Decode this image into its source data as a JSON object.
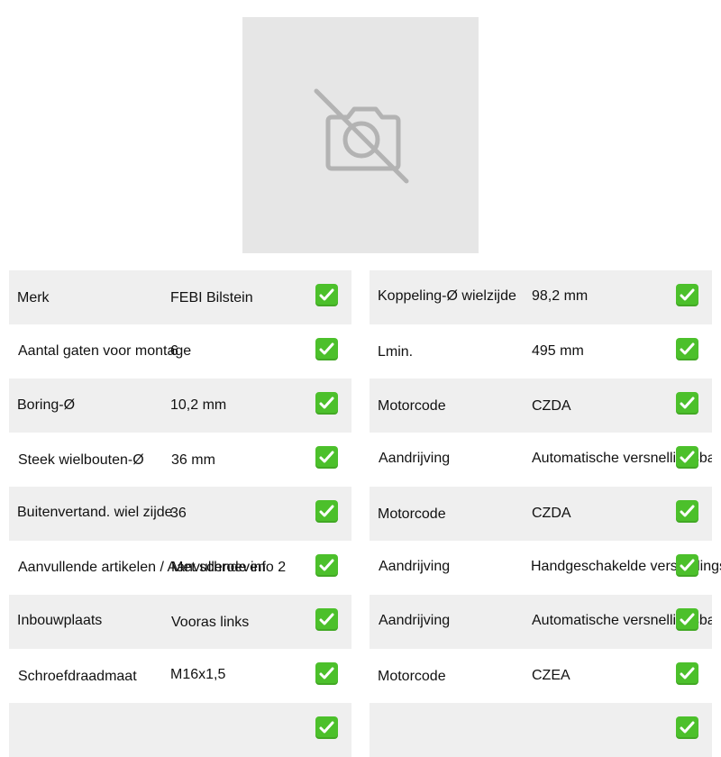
{
  "product_image": {
    "icon": "camera-off-icon",
    "background_color": "#e6e6e6"
  },
  "check_color": "#4cc02b",
  "row_shade_color": "#efefef",
  "left_specs": [
    {
      "label": "Merk",
      "value": "FEBI Bilstein"
    },
    {
      "label": "Aantal gaten voor montage",
      "value": "6"
    },
    {
      "label": "Boring-Ø",
      "value": "10,2 mm"
    },
    {
      "label": "Steek wielbouten-Ø",
      "value": "36 mm"
    },
    {
      "label": "Buitenvertand. wiel zijde",
      "value": "36"
    },
    {
      "label": "Aanvullende artikelen / Aanvullende info 2",
      "value": "Met schroeven"
    },
    {
      "label": "Inbouwplaats",
      "value": "Vooras links"
    },
    {
      "label": "Schroefdraadmaat",
      "value": "M16x1,5"
    },
    {
      "label": "",
      "value": ""
    }
  ],
  "right_specs": [
    {
      "label": "Koppeling-Ø wielzijde",
      "value": "98,2 mm"
    },
    {
      "label": "Lmin.",
      "value": "495 mm"
    },
    {
      "label": "Motorcode",
      "value": "CZDA"
    },
    {
      "label": "Aandrijving",
      "value": "Automatische versnellingsbak"
    },
    {
      "label": "Motorcode",
      "value": "CZDA"
    },
    {
      "label": "Aandrijving",
      "value": "Handgeschakelde versnellingsbak"
    },
    {
      "label": "Aandrijving",
      "value": "Automatische versnellingsbak"
    },
    {
      "label": "Motorcode",
      "value": "CZEA"
    },
    {
      "label": "",
      "value": ""
    }
  ]
}
